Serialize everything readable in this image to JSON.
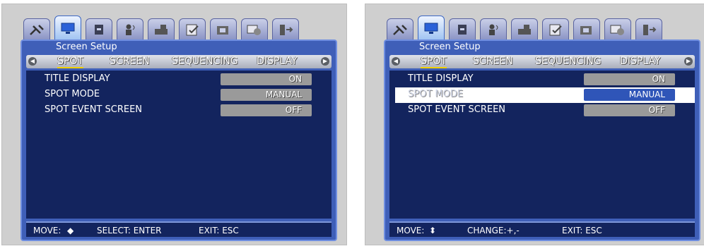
{
  "panels": [
    {
      "title": "Screen Setup",
      "tabs": [
        "SPOT",
        "SCREEN",
        "SEQUENCING",
        "DISPLAY"
      ],
      "rows": [
        {
          "label": "TITLE DISPLAY",
          "value": "ON"
        },
        {
          "label": "SPOT MODE",
          "value": "MANUAL"
        },
        {
          "label": "SPOT EVENT SCREEN",
          "value": "OFF"
        }
      ],
      "status": {
        "move": "MOVE:",
        "move_icon": "◆",
        "select": "SELECT: ENTER",
        "exit": "EXIT: ESC"
      }
    },
    {
      "title": "Screen Setup",
      "tabs": [
        "SPOT",
        "SCREEN",
        "SEQUENCING",
        "DISPLAY"
      ],
      "rows": [
        {
          "label": "TITLE DISPLAY",
          "value": "ON"
        },
        {
          "label": "SPOT MODE",
          "value": "MANUAL"
        },
        {
          "label": "SPOT EVENT SCREEN",
          "value": "OFF"
        }
      ],
      "status": {
        "move": "MOVE:",
        "move_icon": "⬍",
        "change": "CHANGE:+,-",
        "exit": "EXIT: ESC"
      }
    }
  ],
  "colors": {
    "accent": "#3f5fb8",
    "content_bg": "#13245e",
    "highlight": "#2f55b8",
    "underline": "#f2d100"
  }
}
